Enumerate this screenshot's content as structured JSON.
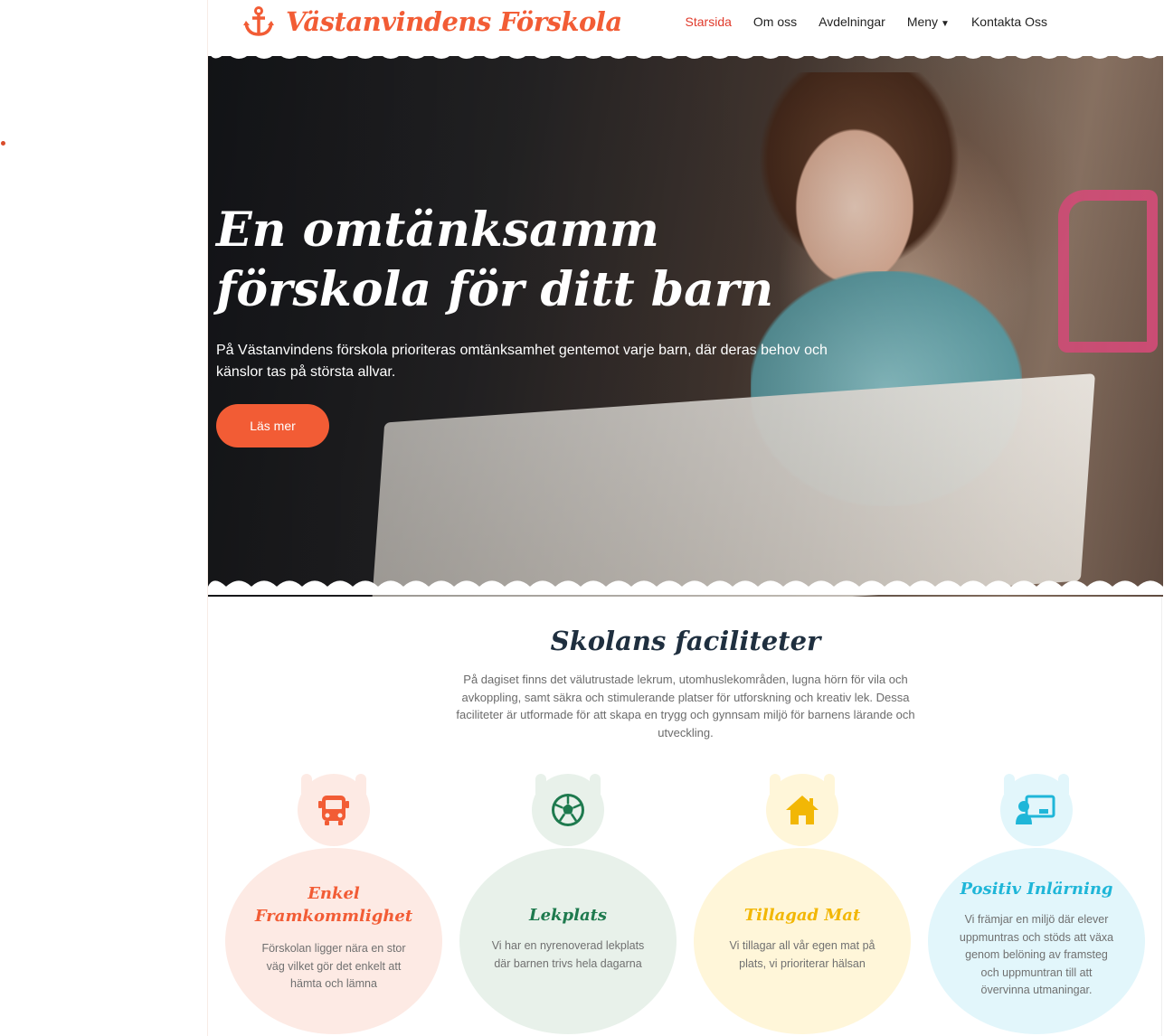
{
  "site": {
    "name": "Västanvindens Förskola"
  },
  "nav": {
    "items": [
      {
        "label": "Starsida"
      },
      {
        "label": "Om oss"
      },
      {
        "label": "Avdelningar"
      },
      {
        "label": "Meny"
      },
      {
        "label": "Kontakta Oss"
      }
    ]
  },
  "hero": {
    "title": "En omtänksamm förskola för ditt barn",
    "subtitle": "På Västanvindens förskola prioriteras omtänksamhet gentemot varje barn, där deras behov och känslor tas på största allvar.",
    "button_label": "Läs mer"
  },
  "facilities": {
    "title": "Skolans faciliteter",
    "description": "På dagiset finns det välutrustade lekrum, utomhuslekområden, lugna hörn för vila och avkoppling, samt säkra och stimulerande platser för utforskning och kreativ lek. Dessa faciliteter är utformade för att skapa en trygg och gynnsam miljö för barnens lärande och utveckling.",
    "cards": [
      {
        "icon": "bus-icon",
        "title": "Enkel Framkommlighet",
        "text": "Förskolan ligger nära en stor väg vilket gör det enkelt att hämta och lämna",
        "color": "#f25c35",
        "bg": "#fdeae4"
      },
      {
        "icon": "soccer-ball-icon",
        "title": "Lekplats",
        "text": "Vi har en nyrenoverad lekplats där barnen trivs hela dagarna",
        "color": "#1e7a4e",
        "bg": "#e8f1ea"
      },
      {
        "icon": "home-icon",
        "title": "Tillagad Mat",
        "text": "Vi tillagar all vår egen mat på plats, vi prioriterar hälsan",
        "color": "#f2b705",
        "bg": "#fff6d9"
      },
      {
        "icon": "teacher-board-icon",
        "title": "Positiv Inlärning",
        "text": "Vi främjar en miljö där elever uppmuntras och stöds att växa genom belöning av framsteg och uppmuntran till att övervinna utmaningar.",
        "color": "#1fb6d8",
        "bg": "#e2f6fb"
      }
    ]
  }
}
